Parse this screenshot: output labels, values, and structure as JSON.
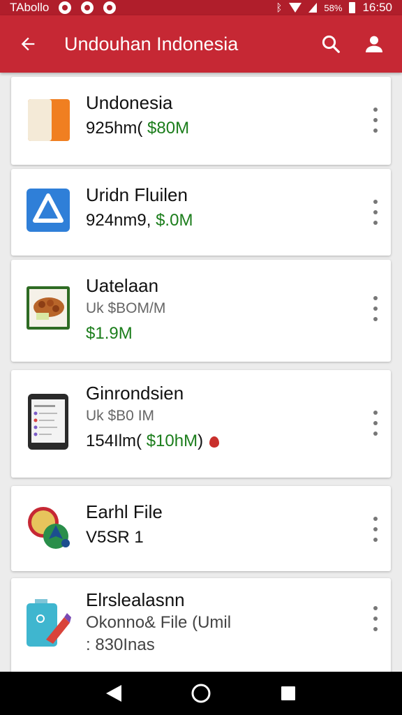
{
  "status_bar": {
    "carrier": "TAbollo",
    "battery": "58%",
    "time": "16:50"
  },
  "app_bar": {
    "title": "Undouhan Indonesia"
  },
  "items": [
    {
      "title": "Undonesia",
      "line1_prefix": "925hm( ",
      "line1_price": "$80M"
    },
    {
      "title": "Uridn Fluilen",
      "line1_prefix": "924nm9, ",
      "line1_price": "$.0M"
    },
    {
      "title": "Uatelaan",
      "subtitle": "Uk $BOM/M",
      "price": "$1.9M"
    },
    {
      "title": "Ginrondsien",
      "subtitle": "Uk $B0 IM",
      "line2_prefix": "154Ilm( ",
      "line2_price": "$10hM",
      "line2_suffix": ")"
    },
    {
      "title": "Earhl File",
      "line1": "V5SR 1"
    },
    {
      "title": "Elrslealasnn",
      "line1": "Okonno& File (Umil",
      "line2": ": 830Inas"
    }
  ]
}
